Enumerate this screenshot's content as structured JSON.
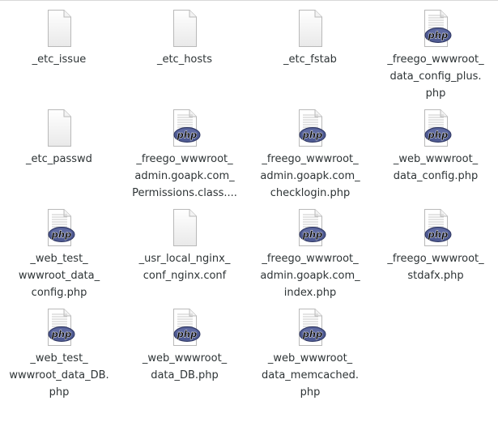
{
  "files": [
    {
      "icon": "text-file-icon",
      "lines": [
        "_etc_issue"
      ]
    },
    {
      "icon": "text-file-icon",
      "lines": [
        "_etc_hosts"
      ]
    },
    {
      "icon": "text-file-icon",
      "lines": [
        "_etc_fstab"
      ]
    },
    {
      "icon": "php-file-icon",
      "lines": [
        "_freego_wwwroot_",
        "data_config_plus.",
        "php"
      ]
    },
    {
      "icon": "text-file-icon",
      "lines": [
        "_etc_passwd"
      ]
    },
    {
      "icon": "php-file-icon",
      "lines": [
        "_freego_wwwroot_",
        "admin.goapk.com_",
        "Permissions.class...."
      ]
    },
    {
      "icon": "php-file-icon",
      "lines": [
        "_freego_wwwroot_",
        "admin.goapk.com_",
        "checklogin.php"
      ]
    },
    {
      "icon": "php-file-icon",
      "lines": [
        "_web_wwwroot_",
        "data_config.php"
      ]
    },
    {
      "icon": "php-file-icon",
      "lines": [
        "_web_test_",
        "wwwroot_data_",
        "config.php"
      ]
    },
    {
      "icon": "text-file-icon",
      "lines": [
        "_usr_local_nginx_",
        "conf_nginx.conf"
      ]
    },
    {
      "icon": "php-file-icon",
      "lines": [
        "_freego_wwwroot_",
        "admin.goapk.com_",
        "index.php"
      ]
    },
    {
      "icon": "php-file-icon",
      "lines": [
        "_freego_wwwroot_",
        "stdafx.php"
      ]
    },
    {
      "icon": "php-file-icon",
      "lines": [
        "_web_test_",
        "wwwroot_data_DB.",
        "php"
      ]
    },
    {
      "icon": "php-file-icon",
      "lines": [
        "_web_wwwroot_",
        "data_DB.php"
      ]
    },
    {
      "icon": "php-file-icon",
      "lines": [
        "_web_wwwroot_",
        "data_memcached.",
        "php"
      ]
    }
  ],
  "php_badge_text": "php"
}
